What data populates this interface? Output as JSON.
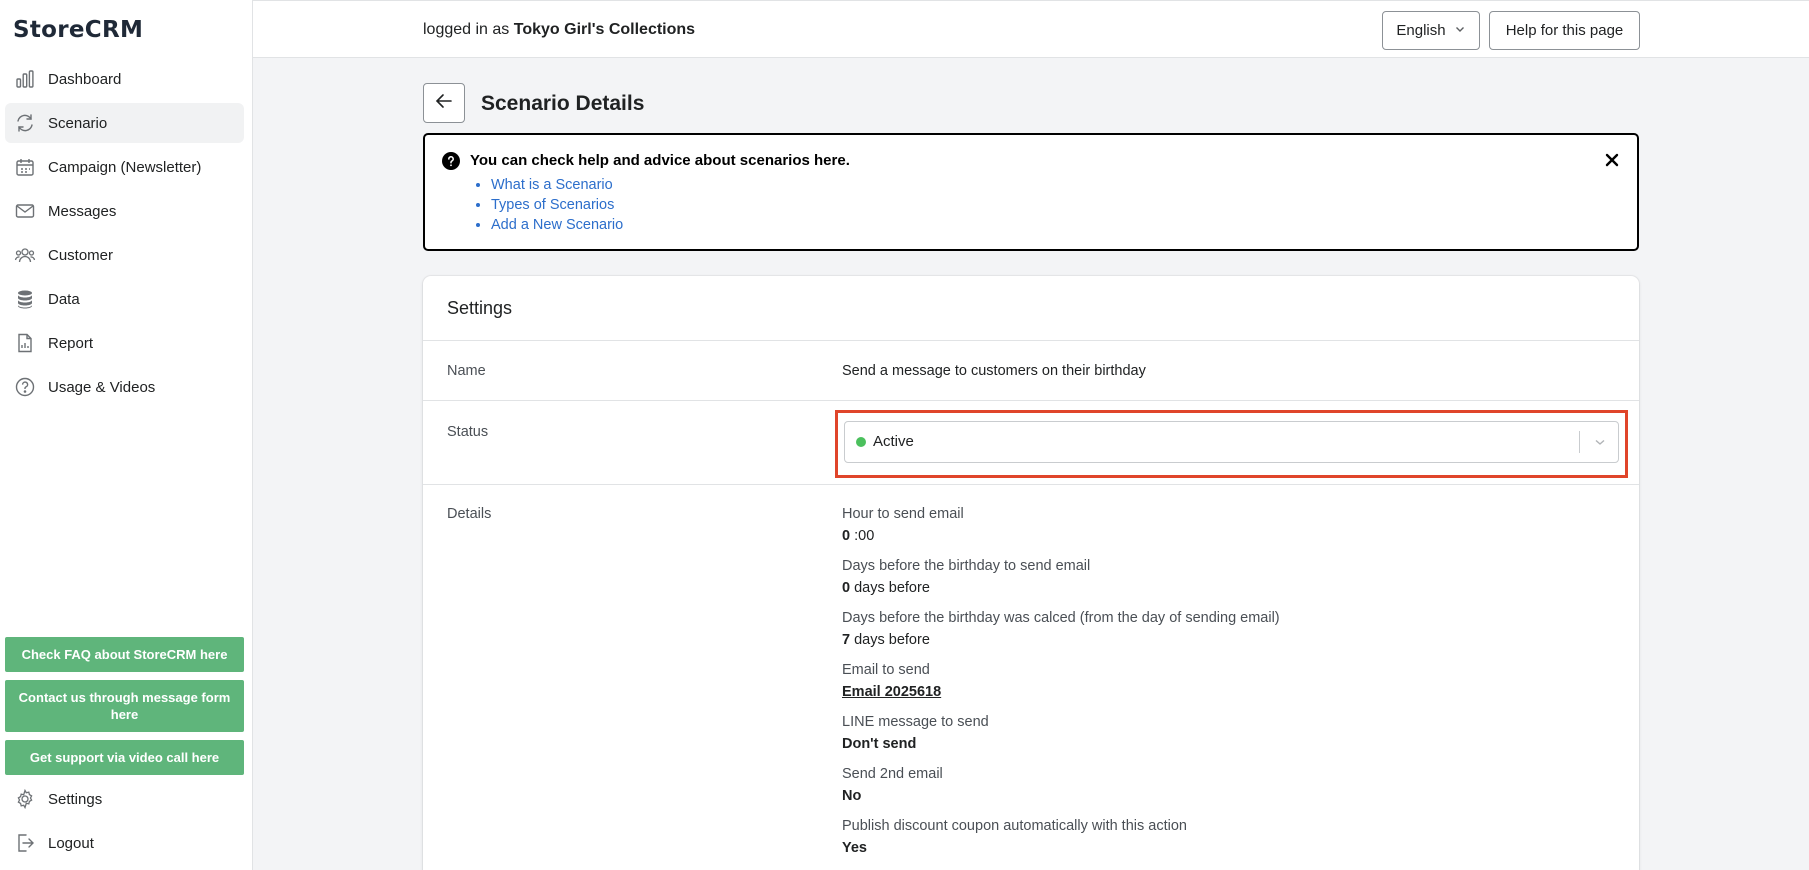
{
  "app": {
    "logo": "StoreCRM"
  },
  "sidebar": {
    "items": [
      {
        "label": "Dashboard",
        "icon": "bar-chart-icon"
      },
      {
        "label": "Scenario",
        "icon": "refresh-icon",
        "active": true
      },
      {
        "label": "Campaign (Newsletter)",
        "icon": "calendar-icon"
      },
      {
        "label": "Messages",
        "icon": "envelope-icon"
      },
      {
        "label": "Customer",
        "icon": "users-icon"
      },
      {
        "label": "Data",
        "icon": "database-icon"
      },
      {
        "label": "Report",
        "icon": "document-icon"
      },
      {
        "label": "Usage & Videos",
        "icon": "question-circle-icon"
      }
    ],
    "faq_button": "Check FAQ about StoreCRM here",
    "contact_button": "Contact us through message form here",
    "video_button": "Get support via video call here",
    "settings_label": "Settings",
    "logout_label": "Logout"
  },
  "topbar": {
    "logged_prefix": "logged in as",
    "store_name": "Tokyo Girl's Collections",
    "language": "English",
    "help_button": "Help for this page"
  },
  "page": {
    "title": "Scenario Details"
  },
  "help_box": {
    "title": "You can check help and advice about scenarios here.",
    "links": [
      "What is a Scenario",
      "Types of Scenarios",
      "Add a New Scenario"
    ]
  },
  "settings": {
    "title": "Settings",
    "name_label": "Name",
    "name_value": "Send a message to customers on their birthday",
    "status_label": "Status",
    "status_value": "Active",
    "status_color": "#4bc05d",
    "details_label": "Details",
    "details": {
      "hour_label": "Hour to send email",
      "hour_value": "0",
      "hour_suffix": ":00",
      "days_before_label": "Days before the birthday to send email",
      "days_before_value": "0",
      "days_before_suffix": "days before",
      "calced_label": "Days before the birthday was calced (from the day of sending email)",
      "calced_value": "7",
      "calced_suffix": "days before",
      "email_label": "Email to send",
      "email_value": "Email 2025618",
      "line_label": "LINE message to send",
      "line_value": "Don't send",
      "second_email_label": "Send 2nd email",
      "second_email_value": "No",
      "coupon_label": "Publish discount coupon automatically with this action",
      "coupon_value": "Yes"
    }
  }
}
